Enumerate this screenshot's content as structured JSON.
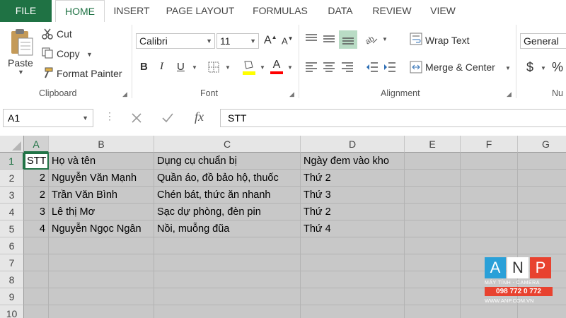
{
  "tabs": {
    "file": "FILE",
    "home": "HOME",
    "insert": "INSERT",
    "page_layout": "PAGE LAYOUT",
    "formulas": "FORMULAS",
    "data": "DATA",
    "review": "REVIEW",
    "view": "VIEW"
  },
  "clipboard": {
    "paste": "Paste",
    "cut": "Cut",
    "copy": "Copy",
    "format_painter": "Format Painter",
    "label": "Clipboard"
  },
  "font": {
    "name": "Calibri",
    "size": "11",
    "grow": "A",
    "shrink": "A",
    "bold": "B",
    "italic": "I",
    "underline": "U",
    "label": "Font",
    "fill_color": "#ffff00",
    "font_color": "#ff0000"
  },
  "alignment": {
    "wrap_text": "Wrap Text",
    "merge_center": "Merge & Center",
    "label": "Alignment"
  },
  "number": {
    "format": "General",
    "currency": "$",
    "percent": "%",
    "label": "Nu"
  },
  "formula_bar": {
    "cell_ref": "A1",
    "fx": "fx",
    "content": "STT"
  },
  "sheet": {
    "columns": [
      "A",
      "B",
      "C",
      "D",
      "E",
      "F",
      "G"
    ],
    "rows": [
      "1",
      "2",
      "3",
      "4",
      "5",
      "6",
      "7",
      "8",
      "9",
      "10"
    ],
    "header": [
      "STT",
      "Họ và tên",
      "Dụng cụ chuẩn bị",
      "Ngày đem vào kho"
    ],
    "data": [
      [
        "2",
        "Nguyễn Văn Mạnh",
        "Quần áo, đồ bảo hộ, thuốc",
        "Thứ 2"
      ],
      [
        "2",
        "Trần Văn Bình",
        "Chén bát, thức ăn nhanh",
        "Thứ 3"
      ],
      [
        "3",
        "Lê thị Mơ",
        "Sạc dự phòng, đèn pin",
        "Thứ 2"
      ],
      [
        "4",
        "Nguyễn Ngọc Ngân",
        "Nồi, muỗng đũa",
        "Thứ 4"
      ]
    ]
  },
  "watermark": {
    "letters": [
      "A",
      "N",
      "P"
    ],
    "tagline": "MÁY TÍNH - CAMERA",
    "phone": "098 772 0 772",
    "site": "WWW.ANP.COM.VN"
  },
  "colors": {
    "accent": "#217346",
    "file_tab": "#1f7244",
    "selection": "#c8c8c8"
  }
}
